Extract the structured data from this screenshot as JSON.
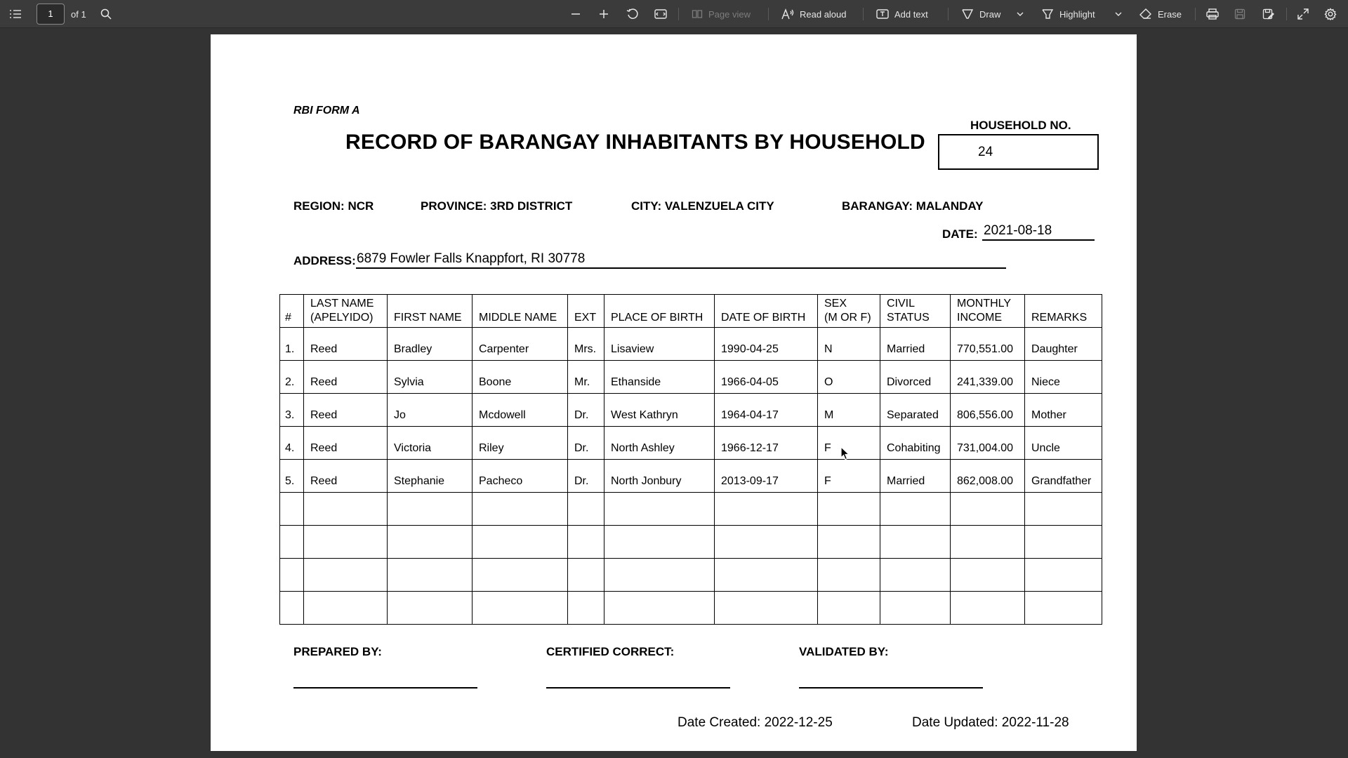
{
  "toolbar": {
    "page_current": "1",
    "page_total_label": "of 1",
    "page_view_label": "Page view",
    "read_aloud_label": "Read aloud",
    "add_text_label": "Add text",
    "draw_label": "Draw",
    "highlight_label": "Highlight",
    "erase_label": "Erase"
  },
  "form": {
    "code": "RBI FORM A",
    "title": "RECORD OF BARANGAY INHABITANTS BY HOUSEHOLD",
    "household_label": "HOUSEHOLD NO.",
    "household_no": "24",
    "region": "REGION: NCR",
    "province": "PROVINCE: 3RD DISTRICT",
    "city": "CITY: VALENZUELA CITY",
    "barangay": "BARANGAY: MALANDAY",
    "date_label": "DATE:",
    "date_value": "2021-08-18",
    "address_label": "ADDRESS:",
    "address_value": "6879 Fowler Falls Knappfort, RI 30778"
  },
  "table": {
    "headers": [
      "#",
      "LAST NAME\n(APELYIDO)",
      "FIRST NAME",
      "MIDDLE NAME",
      "EXT",
      "PLACE OF BIRTH",
      "DATE OF BIRTH",
      "SEX\n(M OR F)",
      "CIVIL\nSTATUS",
      "MONTHLY\nINCOME",
      "REMARKS"
    ],
    "rows": [
      [
        "1.",
        "Reed",
        "Bradley",
        "Carpenter",
        "Mrs.",
        "Lisaview",
        "1990-04-25",
        "N",
        "Married",
        "770,551.00",
        "Daughter"
      ],
      [
        "2.",
        "Reed",
        "Sylvia",
        "Boone",
        "Mr.",
        "Ethanside",
        "1966-04-05",
        "O",
        "Divorced",
        "241,339.00",
        "Niece"
      ],
      [
        "3.",
        "Reed",
        "Jo",
        "Mcdowell",
        "Dr.",
        "West Kathryn",
        "1964-04-17",
        "M",
        "Separated",
        "806,556.00",
        "Mother"
      ],
      [
        "4.",
        "Reed",
        "Victoria",
        "Riley",
        "Dr.",
        "North Ashley",
        "1966-12-17",
        "F",
        "Cohabiting",
        "731,004.00",
        "Uncle"
      ],
      [
        "5.",
        "Reed",
        "Stephanie",
        "Pacheco",
        "Dr.",
        "North Jonbury",
        "2013-09-17",
        "F",
        "Married",
        "862,008.00",
        "Grandfather"
      ],
      [
        "",
        "",
        "",
        "",
        "",
        "",
        "",
        "",
        "",
        "",
        ""
      ],
      [
        "",
        "",
        "",
        "",
        "",
        "",
        "",
        "",
        "",
        "",
        ""
      ],
      [
        "",
        "",
        "",
        "",
        "",
        "",
        "",
        "",
        "",
        "",
        ""
      ],
      [
        "",
        "",
        "",
        "",
        "",
        "",
        "",
        "",
        "",
        "",
        ""
      ]
    ]
  },
  "signatures": {
    "prepared_by": "PREPARED BY:",
    "certified_correct": "CERTIFIED CORRECT:",
    "validated_by": "VALIDATED BY:"
  },
  "footer": {
    "date_created": "Date Created: 2022-12-25",
    "date_updated": "Date Updated: 2022-11-28"
  }
}
